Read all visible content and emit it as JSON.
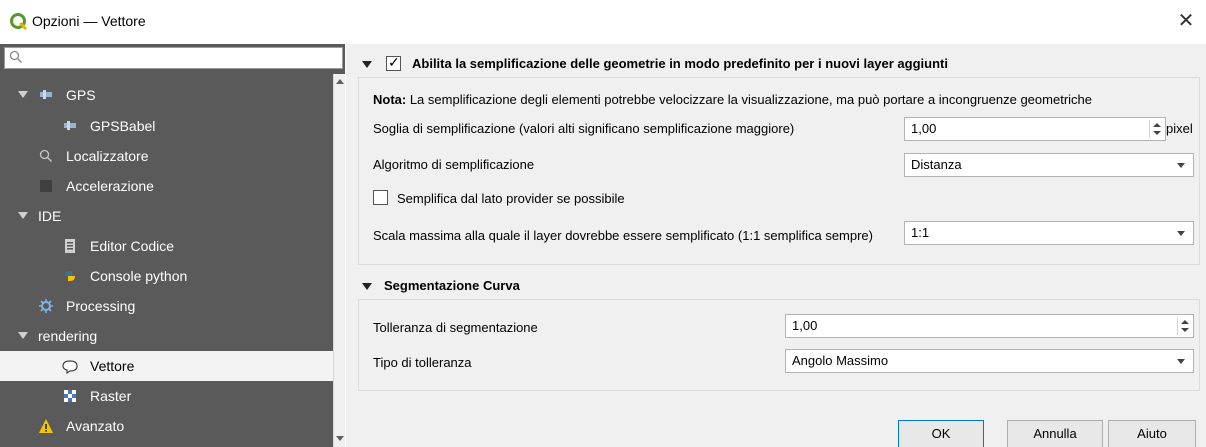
{
  "window": {
    "title": "Opzioni — Vettore",
    "close_label": "✕"
  },
  "sidebar": {
    "search_placeholder": "",
    "items": [
      {
        "label": "GPS",
        "icon": "gps-icon",
        "expanded": true
      },
      {
        "label": "GPSBabel",
        "icon": "gps-icon"
      },
      {
        "label": "Localizzatore",
        "icon": "search-icon"
      },
      {
        "label": "Accelerazione",
        "icon": "acceleration-icon"
      },
      {
        "label": "IDE",
        "expanded": true
      },
      {
        "label": "Editor Codice",
        "icon": "code-editor-icon"
      },
      {
        "label": "Console python",
        "icon": "python-icon"
      },
      {
        "label": "Processing",
        "icon": "processing-gear-icon"
      },
      {
        "label": "rendering",
        "expanded": true
      },
      {
        "label": "Vettore",
        "icon": "vector-icon",
        "selected": true
      },
      {
        "label": "Raster",
        "icon": "raster-icon"
      },
      {
        "label": "Avanzato",
        "icon": "warning-icon"
      }
    ]
  },
  "simplify": {
    "header": "Abilita la semplificazione delle geometrie in modo predefinito per i nuovi layer aggiunti",
    "checked": true,
    "note_bold": "Nota:",
    "note_text": " La semplificazione degli elementi potrebbe velocizzare la visualizzazione, ma può portare a incongruenze geometriche",
    "threshold_label": "Soglia di semplificazione (valori alti significano semplificazione maggiore)",
    "threshold_value": "1,00",
    "threshold_unit": "pixel",
    "algorithm_label": "Algoritmo di semplificazione",
    "algorithm_value": "Distanza",
    "provider_label": "Semplifica dal lato provider se possibile",
    "provider_checked": false,
    "max_scale_label": "Scala massima alla quale il layer dovrebbe essere semplificato (1:1 semplifica sempre)",
    "max_scale_value": "1:1"
  },
  "curve": {
    "header": "Segmentazione Curva",
    "tolerance_label": "Tolleranza di segmentazione",
    "tolerance_value": "1,00",
    "type_label": "Tipo di tolleranza",
    "type_value": "Angolo Massimo"
  },
  "buttons": {
    "ok": "OK",
    "cancel": "Annulla",
    "help": "Aiuto"
  },
  "colors": {
    "sidebar_bg": "#5a5a5a",
    "accent": "#0078d7",
    "warning": "#f5c400"
  }
}
